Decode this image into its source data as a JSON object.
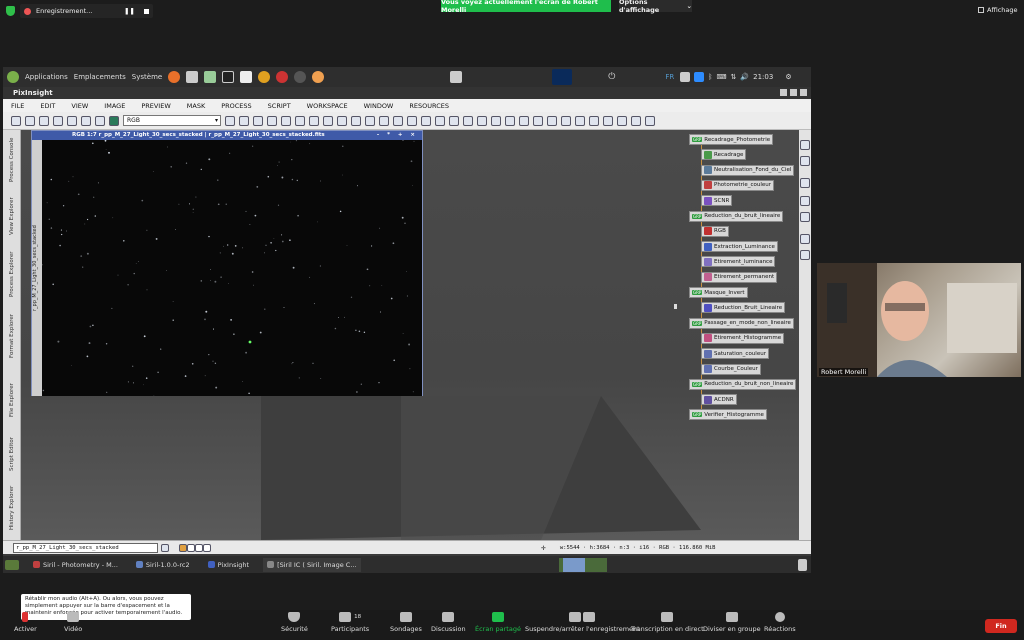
{
  "zoom": {
    "recording_label": "Enregistrement...",
    "share_banner": "Vous voyez actuellement l'écran de Robert Morelli",
    "view_options": "Options d'affichage",
    "display_label": "Affichage",
    "participant_name": "Robert Morelli",
    "participant_count": "18",
    "tooltip": "Rétablir mon audio (Alt+A). Ou alors, vous pouvez simplement appuyer sur la barre d'espacement et la maintenir enfoncée pour activer temporairement l'audio.",
    "controls": {
      "activer": "Activer",
      "video": "Vidéo",
      "securite": "Sécurité",
      "participants": "Participants",
      "sondages": "Sondages",
      "discussion": "Discussion",
      "ecran_partage": "Écran partagé",
      "suspendre": "Suspendre/arrêter l'enregistrement",
      "transcription": "Transcription en direct",
      "diviser": "Diviser en groupe",
      "reactions": "Réactions",
      "fin": "Fin"
    }
  },
  "linux": {
    "applications": "Applications",
    "emplacements": "Emplacements",
    "systeme": "Système",
    "lang": "FR",
    "time": "21:03"
  },
  "pixinsight": {
    "title": "PixInsight",
    "menu": [
      "FILE",
      "EDIT",
      "VIEW",
      "IMAGE",
      "PREVIEW",
      "MASK",
      "PROCESS",
      "SCRIPT",
      "WORKSPACE",
      "WINDOW",
      "RESOURCES"
    ],
    "rgb_select": "RGB",
    "image_title": "RGB 1:7 r_pp_M_27_Light_30_secs_stacked | r_pp_M_27_Light_30_secs_stacked.fits",
    "image_side_tab": "r_pp_M_27_Light_30_secs_stacked",
    "left_tabs": [
      "Process Console",
      "View Explorer",
      "Process Explorer",
      "Format Explorer",
      "File Explorer",
      "Script Editor",
      "History Explorer"
    ],
    "view_name": "r_pp_M_27_Light_30_secs_stacked",
    "status_info": "w:5544 · h:3684 · n:3 · i16 · RGB · 116.860 MiB",
    "process_nodes": [
      {
        "label": "Recadrage_Photometrie",
        "group": true,
        "icon": "#9a8f40"
      },
      {
        "label": "Recadrage",
        "group": false,
        "icon": "#4a9a4a"
      },
      {
        "label": "Neutralisation_Fond_du_Ciel",
        "group": false,
        "icon": "#5a7a9a"
      },
      {
        "label": "Photometrie_couleur",
        "group": false,
        "icon": "#c04040"
      },
      {
        "label": "SCNR",
        "group": false,
        "icon": "#7a50c0"
      },
      {
        "label": "Reduction_du_bruit_lineaire",
        "group": true,
        "icon": "#9a8f40"
      },
      {
        "label": "RGB",
        "group": false,
        "icon": "#c03030"
      },
      {
        "label": "Extraction_Luminance",
        "group": false,
        "icon": "#4060c0"
      },
      {
        "label": "Etirement_luminance",
        "group": false,
        "icon": "#8070c0"
      },
      {
        "label": "Etirement_permanent",
        "group": false,
        "icon": "#c06090"
      },
      {
        "label": "Masque_Invert",
        "group": true,
        "icon": "#9a8f40"
      },
      {
        "label": "Reduction_Bruit_Lineaire",
        "group": false,
        "icon": "#5050c0"
      },
      {
        "label": "Passage_en_mode_non_lineaire",
        "group": true,
        "icon": "#9a8f40"
      },
      {
        "label": "Etirement_Histogramme",
        "group": false,
        "icon": "#c05080"
      },
      {
        "label": "Saturation_couleur",
        "group": false,
        "icon": "#6070b0"
      },
      {
        "label": "Courbe_Couleur",
        "group": false,
        "icon": "#6070b0"
      },
      {
        "label": "Reduction_du_bruit_non_lineaire",
        "group": true,
        "icon": "#9a8f40"
      },
      {
        "label": "ACDNR",
        "group": false,
        "icon": "#6050a0"
      },
      {
        "label": "Verifier_Histogramme",
        "group": true,
        "icon": "#9a8f40"
      }
    ]
  },
  "taskbar": [
    {
      "label": "Siril - Photometry - M...",
      "icon": "#c04040"
    },
    {
      "label": "Siril-1.0.0-rc2",
      "icon": "#6080c0"
    },
    {
      "label": "PixInsight",
      "icon": "#4060c0"
    },
    {
      "label": "[Siril IC ( Siril. Image C...",
      "icon": "#888888"
    }
  ],
  "colors": {
    "zoom_green": "#1fbe4c",
    "end_red": "#d0281f",
    "pi_blue": "#3f5aa8"
  }
}
